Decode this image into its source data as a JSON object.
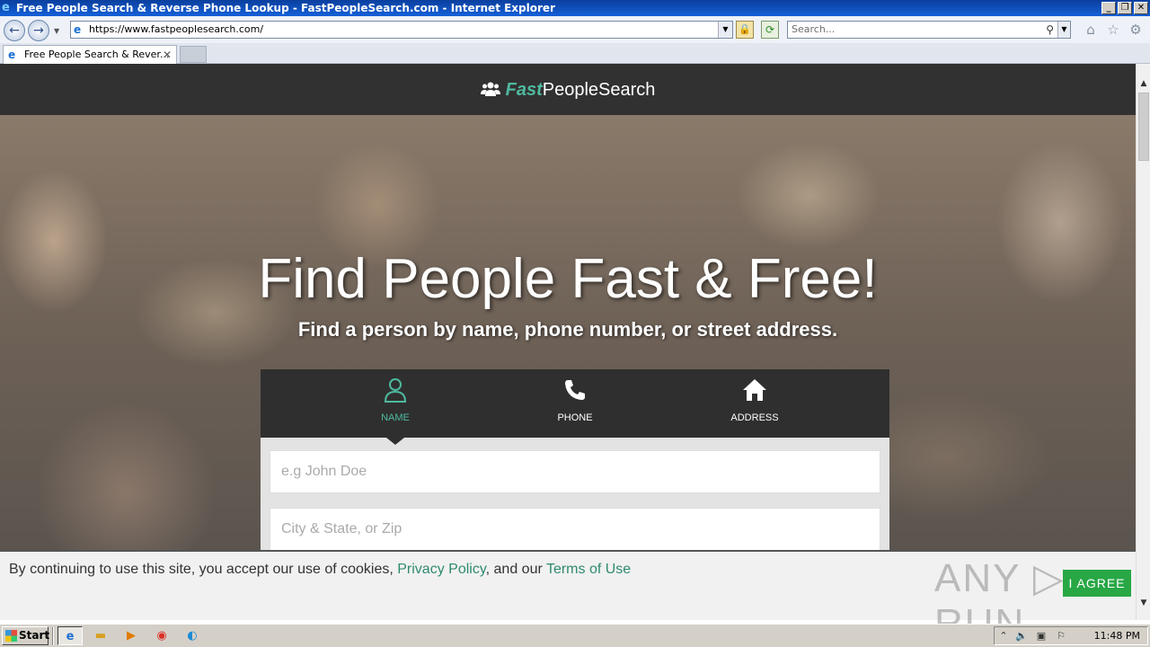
{
  "window": {
    "title": "Free People Search & Reverse Phone Lookup - FastPeopleSearch.com - Internet Explorer",
    "minimize": "_",
    "restore": "❐",
    "close": "✕"
  },
  "navbar": {
    "back": "←",
    "forward": "→",
    "address": "https://www.fastpeoplesearch.com/",
    "search_placeholder": "Search..."
  },
  "tabs": [
    {
      "label": "Free People Search & Rever..."
    }
  ],
  "site": {
    "logo_fast": "Fast",
    "logo_rest": "PeopleSearch",
    "hero_title": "Find People Fast & Free!",
    "hero_subtitle": "Find a person by name, phone number, or street address.",
    "search_tabs": [
      {
        "label": "NAME",
        "active": true
      },
      {
        "label": "PHONE",
        "active": false
      },
      {
        "label": "ADDRESS",
        "active": false
      }
    ],
    "fields": {
      "name_placeholder": "e.g John Doe",
      "location_placeholder": "City & State, or Zip"
    },
    "accent_color": "#4fb99f"
  },
  "cookie": {
    "text_before": "By continuing to use this site, you accept our use of cookies, ",
    "privacy_link": "Privacy Policy",
    "text_middle": ", and our ",
    "terms_link": "Terms of Use",
    "agree_button": "I AGREE",
    "watermark": "ANY ▷ RUN"
  },
  "taskbar": {
    "start": "Start",
    "clock": "11:48 PM"
  }
}
